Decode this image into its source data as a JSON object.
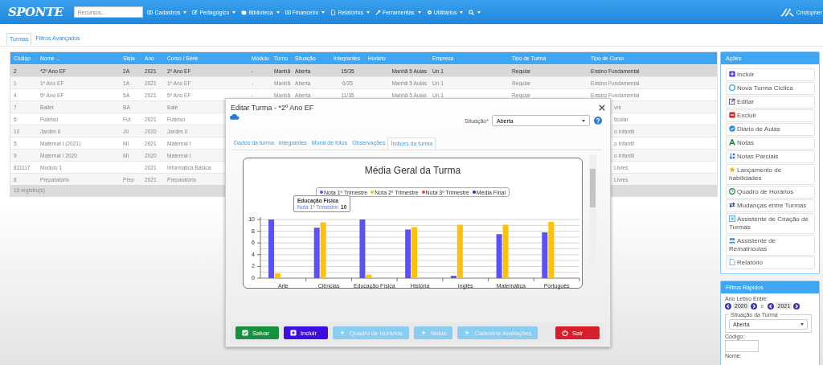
{
  "header": {
    "logo": "SPONTE",
    "search": {
      "placeholder": "Recursos..."
    },
    "menus": [
      "Cadastros",
      "Pedagógico",
      "Biblioteca",
      "Financeiro",
      "Relatórios",
      "Ferramentas",
      "Utilitários"
    ],
    "user": "Cristopher"
  },
  "tabs": [
    {
      "label": "Turmas",
      "selected": true
    },
    {
      "label": "Filtros Avançados",
      "selected": false
    }
  ],
  "table": {
    "columns": [
      "Código",
      "Nome ...",
      "Sigla",
      "Ano",
      "Curso / Série",
      "Módulo",
      "Turno",
      "Situação",
      "Integrantes",
      "Horário",
      "Empresa",
      "Tipo de Turma",
      "Tipo de Curso"
    ],
    "rows": [
      {
        "selected": true,
        "codigo": "2",
        "nome": "*2º Ano EF",
        "sigla": "2A",
        "ano": "2021",
        "curso": "2º Ano EF",
        "modulo": "-",
        "turno": "Manhã",
        "situacao": "Aberta",
        "integrantes": "15/35",
        "horario": "Manhã 5 Aulas",
        "empresa": "Un.1",
        "tipo_turma": "Regular",
        "tipo_curso": "Ensino Fundamental"
      },
      {
        "selected": false,
        "codigo": "1",
        "nome": "1º Ano EF",
        "sigla": "1A",
        "ano": "2021",
        "curso": "1º Ano EF",
        "modulo": "-",
        "turno": "Manhã",
        "situacao": "Aberta",
        "integrantes": "6/35",
        "horario": "Manhã 5 Aulas",
        "empresa": "Un.1",
        "tipo_turma": "Regular",
        "tipo_curso": "Ensino Fundamental"
      },
      {
        "selected": false,
        "codigo": "4",
        "nome": "5º Ano EF",
        "sigla": "5A",
        "ano": "2021",
        "curso": "5º Ano EF",
        "modulo": "-",
        "turno": "Manhã",
        "situacao": "Aberta",
        "integrantes": "11/35",
        "horario": "Manhã 5 Aulas",
        "empresa": "Un.1",
        "tipo_turma": "Regular",
        "tipo_curso": "Ensino Fundamental"
      },
      {
        "selected": false,
        "codigo": "7",
        "nome": "Ballet",
        "sigla": "BA",
        "curso": "Balé",
        "tipo_curso": "vre"
      },
      {
        "selected": false,
        "codigo": "6",
        "nome": "Futebol",
        "sigla": "Fut",
        "ano": "2021",
        "curso": "Futebol",
        "tipo_curso": "ticular"
      },
      {
        "selected": false,
        "codigo": "10",
        "nome": "Jardim II",
        "sigla": "JII",
        "ano": "2020",
        "curso": "Jardim II",
        "tipo_curso": "o Infantil"
      },
      {
        "selected": false,
        "codigo": "5",
        "nome": "Maternal I (2021)",
        "sigla": "MI",
        "ano": "2021",
        "curso": "Maternal I",
        "tipo_curso": "o Infantil"
      },
      {
        "selected": false,
        "codigo": "9",
        "nome": "Maternal I 2020",
        "sigla": "MI",
        "ano": "2020",
        "curso": "Maternal I",
        "tipo_curso": "o Infantil"
      },
      {
        "selected": false,
        "codigo": "811117",
        "nome": "Modulo 1",
        "ano": "2021",
        "curso": "Informática Básica",
        "tipo_curso": "Livres"
      },
      {
        "selected": false,
        "codigo": "8",
        "nome": "Preparatório",
        "sigla": "Prep",
        "ano": "2021",
        "curso": "Preparatório",
        "tipo_curso": "Livres"
      }
    ],
    "footer": "10 registro(s)"
  },
  "actions": {
    "title": "Ações",
    "items": [
      "Incluir",
      "Nova Turma Cíclica",
      "Editar",
      "Excluir",
      "Diário de Aulas",
      "Notas",
      "Notas Parciais",
      "Lançamento de habilidades",
      "Quadro de Horários",
      "Mudanças entre Turmas",
      "Assistente de Criação de Turmas",
      "Assistente de Rematrículas",
      "Relatório"
    ]
  },
  "quick_filters": {
    "title": "Filtros Rápidos",
    "year_label": "Ano Letivo Entre:",
    "year_from": "2020",
    "between": "e",
    "year_to": "2021",
    "status_legend": "Situação da Turma",
    "status_value": "Aberta",
    "code_label": "Código:",
    "name_label": "Nome:"
  },
  "modal": {
    "title": "Editar Turma - *2º Ano EF",
    "status_label": "Situação",
    "required_mark": "*",
    "status_value": "Aberta",
    "tabs": [
      {
        "label": "Dados da turma",
        "selected": false
      },
      {
        "label": "Integrantes",
        "selected": false
      },
      {
        "label": "Mural de fotos",
        "selected": false
      },
      {
        "label": "Observações",
        "selected": false
      },
      {
        "label": "Índices da turma",
        "selected": true
      }
    ],
    "chart_data": {
      "type": "bar",
      "title": "Média Geral da Turma",
      "categories": [
        "Arte",
        "Ciências",
        "Educação Física",
        "História",
        "Inglês",
        "Matemática",
        "Português"
      ],
      "ylim": [
        0,
        10
      ],
      "yticks": [
        0,
        2,
        4,
        6,
        8,
        10
      ],
      "grid": true,
      "legend": "top",
      "series": [
        {
          "name": "Nota 1º Trimestre",
          "color": "#5b52f5",
          "values": [
            10,
            8.6,
            10,
            8.3,
            0.4,
            7.5,
            7.8
          ]
        },
        {
          "name": "Nota 2º Trimestre",
          "color": "#ffc10a",
          "values": [
            0.8,
            9.5,
            0.6,
            8.7,
            9.1,
            9.1,
            9.6
          ]
        },
        {
          "name": "Nota 3º Trimestre",
          "color": "#e8501a",
          "values": [
            null,
            null,
            null,
            null,
            null,
            null,
            null
          ]
        },
        {
          "name": "Média Final",
          "color": "#2a2ab0",
          "values": [
            null,
            null,
            null,
            null,
            null,
            null,
            null
          ]
        }
      ]
    },
    "tooltip": {
      "title": "Educação Física",
      "label": "Nota 1º Trimestre:",
      "value": "10"
    },
    "buttons": [
      {
        "label": "Salvar",
        "kind": "success",
        "disabled": false
      },
      {
        "label": "Incluir",
        "kind": "primary",
        "disabled": false
      },
      {
        "label": "Quadro de Horários",
        "kind": "info",
        "disabled": true
      },
      {
        "label": "Notas",
        "kind": "info",
        "disabled": true
      },
      {
        "label": "Cadestrar Avaliações",
        "kind": "info",
        "disabled": true
      },
      {
        "label": "Sair",
        "kind": "danger",
        "disabled": false
      }
    ]
  }
}
